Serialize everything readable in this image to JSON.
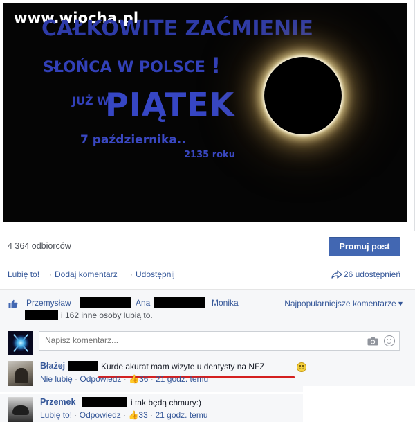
{
  "banner": {
    "watermark": "www.wiocha.pl",
    "line1": "CAŁKOWITE ZAĆMIENIE",
    "line2": "SŁOŃCA W POLSCE",
    "line2_bang": "!",
    "juz_w": "JUŻ W",
    "piatek": "PIĄTEK",
    "date": "7 października..",
    "year": "2135 roku"
  },
  "stats": {
    "reach": "4 364 odbiorców",
    "promote_label": "Promuj post"
  },
  "actions": {
    "like": "Lubię to!",
    "comment": "Dodaj komentarz",
    "share": "Udostępnij",
    "separator": "·",
    "shares_count": "26 udostępnień"
  },
  "likes": {
    "name1": "Przemysław",
    "name2": "Ana",
    "name3": "Monika",
    "others": "i 162 inne osoby lubią to.",
    "popular_label": "Najpopularniejsze komentarze ▾"
  },
  "comment_input": {
    "placeholder": "Napisz komentarz..."
  },
  "comments": [
    {
      "name": "Błażej",
      "text": "Kurde akurat mam wizyte u dentysty na NFZ",
      "like_action": "Nie lubię",
      "reply": "Odpowiedz",
      "likes": "36",
      "time": "21 godz. temu"
    },
    {
      "name": "Przemek",
      "text": "i tak będą chmury:)",
      "like_action": "Lubię to!",
      "reply": "Odpowiedz",
      "likes": "33",
      "time": "21 godz. temu"
    }
  ],
  "colors": {
    "link": "#365899",
    "button": "#4267b2",
    "banner_text": "#3646c4",
    "underline": "#d42020"
  }
}
